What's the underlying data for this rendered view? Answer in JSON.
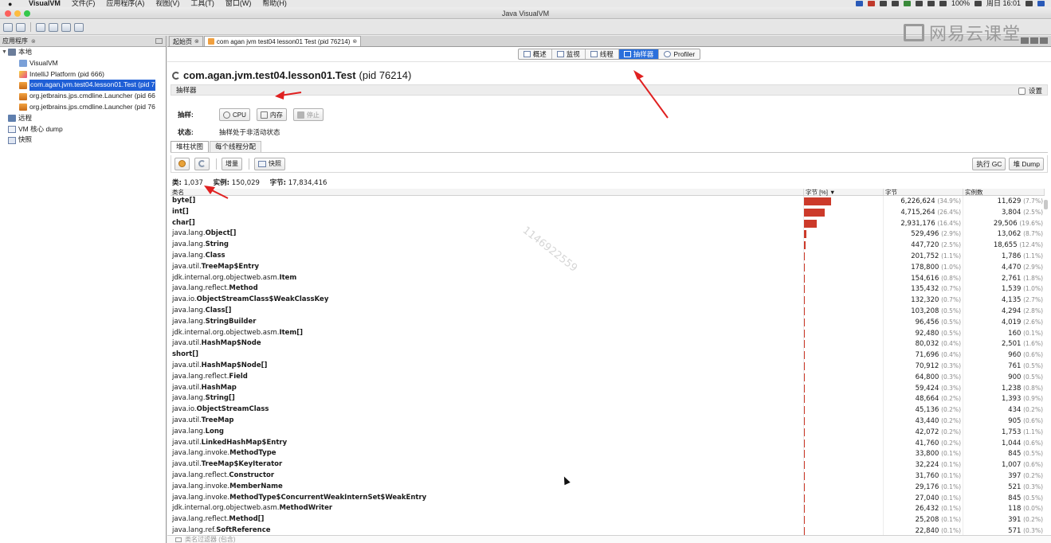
{
  "menubar": {
    "app": "VisualVM",
    "items": [
      "文件(F)",
      "应用程序(A)",
      "视图(V)",
      "工具(T)",
      "窗口(W)",
      "帮助(H)"
    ],
    "battery": "100%",
    "clock": "周日 16:01"
  },
  "window": {
    "title": "Java VisualVM"
  },
  "left_panel": {
    "tab_label": "应用程序",
    "tree": [
      {
        "label": "本地",
        "icon": "host-icon",
        "level": 0,
        "caret": "▼"
      },
      {
        "label": "VisualVM",
        "icon": "visualvm-icon",
        "level": 1
      },
      {
        "label": "IntelliJ Platform (pid 666)",
        "icon": "intellij-icon",
        "level": 1
      },
      {
        "label": "com.agan.jvm.test04.lesson01.Test (pid 7",
        "icon": "java-process-icon",
        "level": 1,
        "selected": true
      },
      {
        "label": "org.jetbrains.jps.cmdline.Launcher (pid 66",
        "icon": "java-process-icon",
        "level": 1
      },
      {
        "label": "org.jetbrains.jps.cmdline.Launcher (pid 76",
        "icon": "java-process-icon",
        "level": 1
      },
      {
        "label": "远程",
        "icon": "remote-icon",
        "level": 0
      },
      {
        "label": "VM 核心 dump",
        "icon": "core-dump-icon",
        "level": 0
      },
      {
        "label": "快照",
        "icon": "snapshot-icon",
        "level": 0
      }
    ]
  },
  "doc_tabs": [
    {
      "label": "起始页",
      "active": false
    },
    {
      "label": "com agan jvm test04 lesson01 Test (pid 76214)",
      "active": true
    }
  ],
  "watermark_brand": "网易云课堂",
  "view_tabs": [
    {
      "label": "概述",
      "active": false
    },
    {
      "label": "监视",
      "active": false
    },
    {
      "label": "线程",
      "active": false
    },
    {
      "label": "抽样器",
      "active": true
    },
    {
      "label": "Profiler",
      "active": false
    }
  ],
  "app_title": {
    "name": "com.agan.jvm.test04.lesson01.Test",
    "pid": "(pid 76214)"
  },
  "sampler": {
    "header": "抽样器",
    "settings_label": "设置",
    "sample_label": "抽样:",
    "cpu_button": "CPU",
    "memory_button": "内存",
    "stop_button": "停止",
    "status_label": "状态:",
    "status_value": "抽样处于非活动状态"
  },
  "sub_tabs": [
    {
      "label": "堆柱状图",
      "active": true
    },
    {
      "label": "每个线程分配",
      "active": false
    }
  ],
  "actions": {
    "delta_button": "增量",
    "snapshot_button": "快照",
    "gc_button": "执行 GC",
    "heap_dump_button": "堆 Dump"
  },
  "summary": {
    "classes_label": "类:",
    "classes_value": "1,037",
    "instances_label": "实例:",
    "instances_value": "150,029",
    "bytes_label": "字节:",
    "bytes_value": "17,834,416"
  },
  "table": {
    "columns": {
      "name": "类名",
      "bar": "字节 [%] ▼",
      "bytes": "字节",
      "instances": "实例数"
    },
    "rows": [
      {
        "pre": "",
        "bold": "byte[]",
        "bytes": "6,226,624",
        "bpct": "(34.9%)",
        "inst": "11,629",
        "ipct": "(7.7%)",
        "share": 34.9
      },
      {
        "pre": "",
        "bold": "int[]",
        "bytes": "4,715,264",
        "bpct": "(26.4%)",
        "inst": "3,804",
        "ipct": "(2.5%)",
        "share": 26.4
      },
      {
        "pre": "",
        "bold": "char[]",
        "bytes": "2,931,176",
        "bpct": "(16.4%)",
        "inst": "29,506",
        "ipct": "(19.6%)",
        "share": 16.4
      },
      {
        "pre": "java.lang.",
        "bold": "Object[]",
        "bytes": "529,496",
        "bpct": "(2.9%)",
        "inst": "13,062",
        "ipct": "(8.7%)",
        "share": 2.9
      },
      {
        "pre": "java.lang.",
        "bold": "String",
        "bytes": "447,720",
        "bpct": "(2.5%)",
        "inst": "18,655",
        "ipct": "(12.4%)",
        "share": 2.5
      },
      {
        "pre": "java.lang.",
        "bold": "Class",
        "bytes": "201,752",
        "bpct": "(1.1%)",
        "inst": "1,786",
        "ipct": "(1.1%)",
        "share": 1.1
      },
      {
        "pre": "java.util.",
        "bold": "TreeMap$Entry",
        "bytes": "178,800",
        "bpct": "(1.0%)",
        "inst": "4,470",
        "ipct": "(2.9%)",
        "share": 1.0
      },
      {
        "pre": "jdk.internal.org.objectweb.asm.",
        "bold": "Item",
        "bytes": "154,616",
        "bpct": "(0.8%)",
        "inst": "2,761",
        "ipct": "(1.8%)",
        "share": 0.8
      },
      {
        "pre": "java.lang.reflect.",
        "bold": "Method",
        "bytes": "135,432",
        "bpct": "(0.7%)",
        "inst": "1,539",
        "ipct": "(1.0%)",
        "share": 0.7
      },
      {
        "pre": "java.io.",
        "bold": "ObjectStreamClass$WeakClassKey",
        "bytes": "132,320",
        "bpct": "(0.7%)",
        "inst": "4,135",
        "ipct": "(2.7%)",
        "share": 0.7
      },
      {
        "pre": "java.lang.",
        "bold": "Class[]",
        "bytes": "103,208",
        "bpct": "(0.5%)",
        "inst": "4,294",
        "ipct": "(2.8%)",
        "share": 0.5
      },
      {
        "pre": "java.lang.",
        "bold": "StringBuilder",
        "bytes": "96,456",
        "bpct": "(0.5%)",
        "inst": "4,019",
        "ipct": "(2.6%)",
        "share": 0.5
      },
      {
        "pre": "jdk.internal.org.objectweb.asm.",
        "bold": "Item[]",
        "bytes": "92,480",
        "bpct": "(0.5%)",
        "inst": "160",
        "ipct": "(0.1%)",
        "share": 0.5
      },
      {
        "pre": "java.util.",
        "bold": "HashMap$Node",
        "bytes": "80,032",
        "bpct": "(0.4%)",
        "inst": "2,501",
        "ipct": "(1.6%)",
        "share": 0.4
      },
      {
        "pre": "",
        "bold": "short[]",
        "bytes": "71,696",
        "bpct": "(0.4%)",
        "inst": "960",
        "ipct": "(0.6%)",
        "share": 0.4
      },
      {
        "pre": "java.util.",
        "bold": "HashMap$Node[]",
        "bytes": "70,912",
        "bpct": "(0.3%)",
        "inst": "761",
        "ipct": "(0.5%)",
        "share": 0.3
      },
      {
        "pre": "java.lang.reflect.",
        "bold": "Field",
        "bytes": "64,800",
        "bpct": "(0.3%)",
        "inst": "900",
        "ipct": "(0.5%)",
        "share": 0.3
      },
      {
        "pre": "java.util.",
        "bold": "HashMap",
        "bytes": "59,424",
        "bpct": "(0.3%)",
        "inst": "1,238",
        "ipct": "(0.8%)",
        "share": 0.3
      },
      {
        "pre": "java.lang.",
        "bold": "String[]",
        "bytes": "48,664",
        "bpct": "(0.2%)",
        "inst": "1,393",
        "ipct": "(0.9%)",
        "share": 0.2
      },
      {
        "pre": "java.io.",
        "bold": "ObjectStreamClass",
        "bytes": "45,136",
        "bpct": "(0.2%)",
        "inst": "434",
        "ipct": "(0.2%)",
        "share": 0.2
      },
      {
        "pre": "java.util.",
        "bold": "TreeMap",
        "bytes": "43,440",
        "bpct": "(0.2%)",
        "inst": "905",
        "ipct": "(0.6%)",
        "share": 0.2
      },
      {
        "pre": "java.lang.",
        "bold": "Long",
        "bytes": "42,072",
        "bpct": "(0.2%)",
        "inst": "1,753",
        "ipct": "(1.1%)",
        "share": 0.2
      },
      {
        "pre": "java.util.",
        "bold": "LinkedHashMap$Entry",
        "bytes": "41,760",
        "bpct": "(0.2%)",
        "inst": "1,044",
        "ipct": "(0.6%)",
        "share": 0.2
      },
      {
        "pre": "java.lang.invoke.",
        "bold": "MethodType",
        "bytes": "33,800",
        "bpct": "(0.1%)",
        "inst": "845",
        "ipct": "(0.5%)",
        "share": 0.1
      },
      {
        "pre": "java.util.",
        "bold": "TreeMap$KeyIterator",
        "bytes": "32,224",
        "bpct": "(0.1%)",
        "inst": "1,007",
        "ipct": "(0.6%)",
        "share": 0.1
      },
      {
        "pre": "java.lang.reflect.",
        "bold": "Constructor",
        "bytes": "31,760",
        "bpct": "(0.1%)",
        "inst": "397",
        "ipct": "(0.2%)",
        "share": 0.1
      },
      {
        "pre": "java.lang.invoke.",
        "bold": "MemberName",
        "bytes": "29,176",
        "bpct": "(0.1%)",
        "inst": "521",
        "ipct": "(0.3%)",
        "share": 0.1
      },
      {
        "pre": "java.lang.invoke.",
        "bold": "MethodType$ConcurrentWeakInternSet$WeakEntry",
        "bytes": "27,040",
        "bpct": "(0.1%)",
        "inst": "845",
        "ipct": "(0.5%)",
        "share": 0.1
      },
      {
        "pre": "jdk.internal.org.objectweb.asm.",
        "bold": "MethodWriter",
        "bytes": "26,432",
        "bpct": "(0.1%)",
        "inst": "118",
        "ipct": "(0.0%)",
        "share": 0.1
      },
      {
        "pre": "java.lang.reflect.",
        "bold": "Method[]",
        "bytes": "25,208",
        "bpct": "(0.1%)",
        "inst": "391",
        "ipct": "(0.2%)",
        "share": 0.1
      },
      {
        "pre": "java.lang.ref.",
        "bold": "SoftReference",
        "bytes": "22,840",
        "bpct": "(0.1%)",
        "inst": "571",
        "ipct": "(0.3%)",
        "share": 0.1
      }
    ]
  },
  "filter": {
    "placeholder": "类名过滤器 (包含)"
  },
  "overlay_watermark": "1146922559",
  "colors": {
    "bar": "#cc3a2a",
    "selection": "#1f5fd6",
    "active_tab": "#2a6fdb",
    "arrow": "#e02020"
  }
}
